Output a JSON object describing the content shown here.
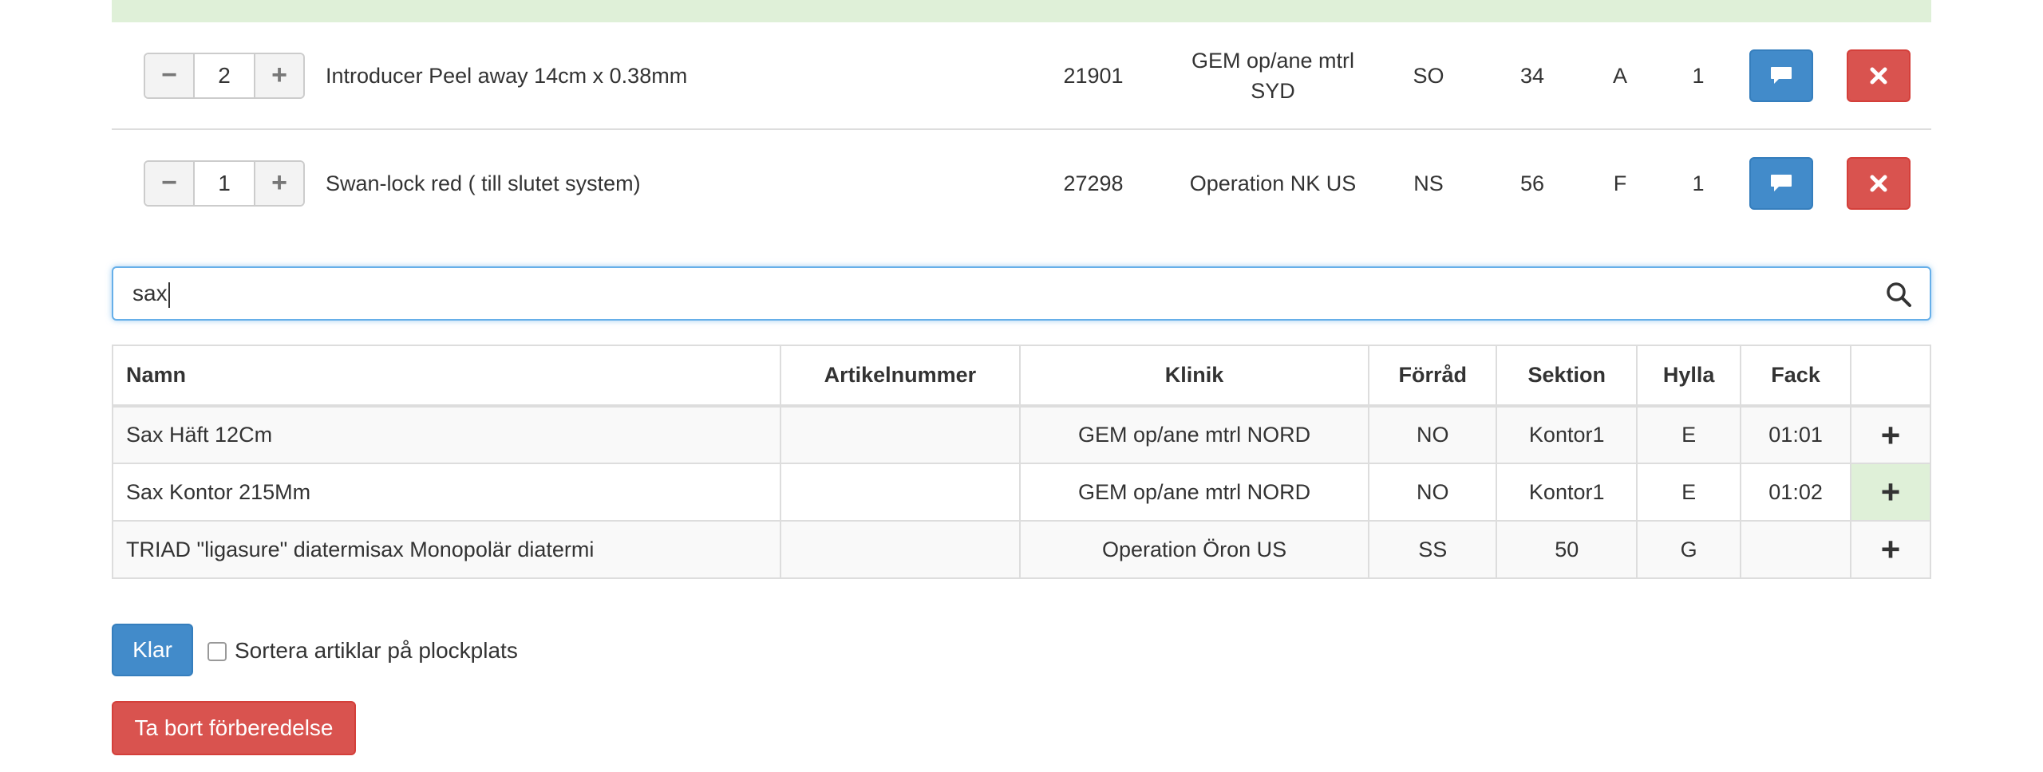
{
  "selected_items": [
    {
      "quantity": "2",
      "name": "Introducer Peel away 14cm x 0.38mm",
      "article_number": "21901",
      "clinic_line1": "GEM op/ane mtrl",
      "clinic_line2": "SYD",
      "storage": "SO",
      "section": "34",
      "shelf": "A",
      "compartment": "1"
    },
    {
      "quantity": "1",
      "name": "Swan-lock red ( till slutet system)",
      "article_number": "27298",
      "clinic_line1": "Operation NK US",
      "clinic_line2": "",
      "storage": "NS",
      "section": "56",
      "shelf": "F",
      "compartment": "1"
    }
  ],
  "stepper": {
    "minus": "−",
    "plus": "+"
  },
  "search": {
    "value": "sax",
    "icon": "search-icon"
  },
  "results_table": {
    "headers": {
      "name": "Namn",
      "article_number": "Artikelnummer",
      "clinic": "Klinik",
      "storage": "Förråd",
      "section": "Sektion",
      "shelf": "Hylla",
      "compartment": "Fack"
    },
    "rows": [
      {
        "name": "Sax Häft 12Cm",
        "article_number": "",
        "clinic": "GEM op/ane mtrl NORD",
        "storage": "NO",
        "section": "Kontor1",
        "shelf": "E",
        "compartment": "01:01"
      },
      {
        "name": "Sax Kontor 215Mm",
        "article_number": "",
        "clinic": "GEM op/ane mtrl NORD",
        "storage": "NO",
        "section": "Kontor1",
        "shelf": "E",
        "compartment": "01:02"
      },
      {
        "name": "TRIAD \"ligasure\" diatermisax Monopolär diatermi",
        "article_number": "",
        "clinic": "Operation Öron US",
        "storage": "SS",
        "section": "50",
        "shelf": "G",
        "compartment": ""
      }
    ],
    "add_symbol": "+"
  },
  "actions": {
    "done_label": "Klar",
    "sort_label": "Sortera artiklar på plockplats",
    "delete_prep_label": "Ta bort förberedelse"
  },
  "colors": {
    "primary": "#428bca",
    "danger": "#d9534f",
    "success_bg": "#dff0d8"
  }
}
